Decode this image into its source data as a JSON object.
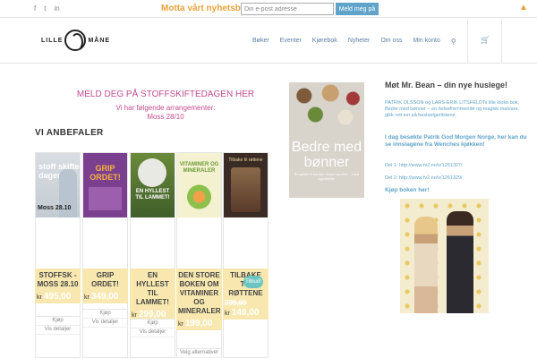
{
  "topbar": {
    "social_icons": [
      "facebook-icon",
      "twitter-icon",
      "linkedin-icon"
    ],
    "social_glyphs": [
      "f",
      "t",
      "in"
    ],
    "newsletter_label": "Motta vårt nyhetsbrev",
    "email_placeholder": "Din e-post adresse",
    "signup_label": "Meld meg på",
    "scroll_up_glyph": "▲"
  },
  "header": {
    "logo_left": "LILLE",
    "logo_right": "MÅNE",
    "nav": [
      "Bøker",
      "Eventer",
      "Kjørebok",
      "Nyheter",
      "Om oss",
      "Min konto"
    ],
    "search_glyph": "⚲",
    "cart_glyph": "🛒"
  },
  "main": {
    "stoff_heading": "MELD DEG PÅ STOFFSKIFTEDAGEN HER",
    "stoff_line1": "Vi har følgende arrangementer:",
    "stoff_line2": "Moss 28/10",
    "recommend_heading": "VI ANBEFALER"
  },
  "cover_text": {
    "c1_title": "stoff skifte dagen",
    "c1_place": "Moss 28.10",
    "c2_title": "GRIP ORDET!",
    "c3_title": "EN HYLLEST TIL LAMMET!",
    "c4_title": "VITAMINER OG MINERALER",
    "c5_title": "Tilbake til røttene"
  },
  "products": [
    {
      "title": "STOFFSK - MOSS 28.10",
      "kr": "kr",
      "price": "495,00",
      "actions": [
        "Kjøp",
        "Vis detaljer"
      ]
    },
    {
      "title": "GRIP ORDET!",
      "kr": "kr",
      "price": "349,00",
      "actions": [
        "Kjøp",
        "Vis detaljer"
      ]
    },
    {
      "title": "EN HYLLEST TIL LAMMET!",
      "kr": "kr",
      "price": "299,00",
      "actions": [
        "Kjøp",
        "Vis detaljer"
      ]
    },
    {
      "title": "DEN STORE BOKEN OM VITAMINER OG MINERALER",
      "kr": "kr",
      "price": "199,00",
      "actions": [
        "Velg alternativer",
        "Vis detaljer"
      ]
    },
    {
      "title": "TILBAKE TIL RØTTENE",
      "kr": "kr",
      "price": "149,00",
      "old_price": "399,00",
      "actions": [
        "Kjøp",
        "Vis detaljer"
      ]
    }
  ],
  "sale_badge": "Tilbud!",
  "feature_cover": {
    "title": "Bedre med bønner",
    "subtitle": "En guide til bønner, linser og erter – med oppskrifter"
  },
  "sidebar": {
    "title": "Møt Mr. Bean – din nye huslege!",
    "intro": "PATRIK OLSSON og LARS-ERIK LITSFELDTs lille kloke bok, Bedre med bønner – en helsefremmende og magisk matvare, gikk rett inn på bestselgerlistene.",
    "bold_text": "I dag besøkte Patrik God Morgen Norge, her kan du se innslagene fra Wenches kjøkken!",
    "link1": "Del 1: http://www.tv2.no/v/1261327/",
    "link2": "Del 2: http://www.tv2.no/v/1261329/",
    "buy_link": "Kjøp boken her!"
  }
}
